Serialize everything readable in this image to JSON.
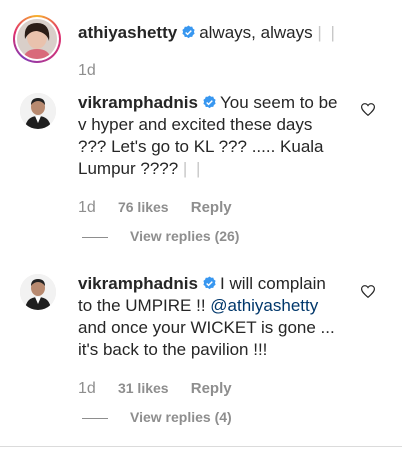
{
  "comments": [
    {
      "username": "athiyashetty",
      "verified": true,
      "text": "always, always",
      "cursor": "| |",
      "time": "1d",
      "avatar": "woman-avatar"
    },
    {
      "username": "vikramphadnis",
      "verified": true,
      "text_lines": [
        "You seem to be",
        "v hyper and excited these days",
        "??? Let's go to KL ??? ..... Kuala",
        "Lumpur ????"
      ],
      "cursor": "| |",
      "time": "1d",
      "likes": "76 likes",
      "reply_label": "Reply",
      "view_replies": "View replies (26)",
      "avatar": "man-avatar"
    },
    {
      "username": "vikramphadnis",
      "verified": true,
      "text_first": "I will complain",
      "text_line2_prefix": "to the UMPIRE !! ",
      "mention": "@athiyashetty",
      "text_line3": "and once your WICKET is gone ...",
      "text_line4": "it's back to the pavilion !!!",
      "time": "1d",
      "likes": "31 likes",
      "reply_label": "Reply",
      "view_replies": "View replies (4)",
      "avatar": "man-avatar"
    }
  ],
  "colors": {
    "primary_text": "#262626",
    "secondary_text": "#8e8e8e",
    "verified_badge": "#3897f0",
    "mention": "#00376b"
  },
  "icons": [
    "verified-badge-icon",
    "heart-icon"
  ]
}
